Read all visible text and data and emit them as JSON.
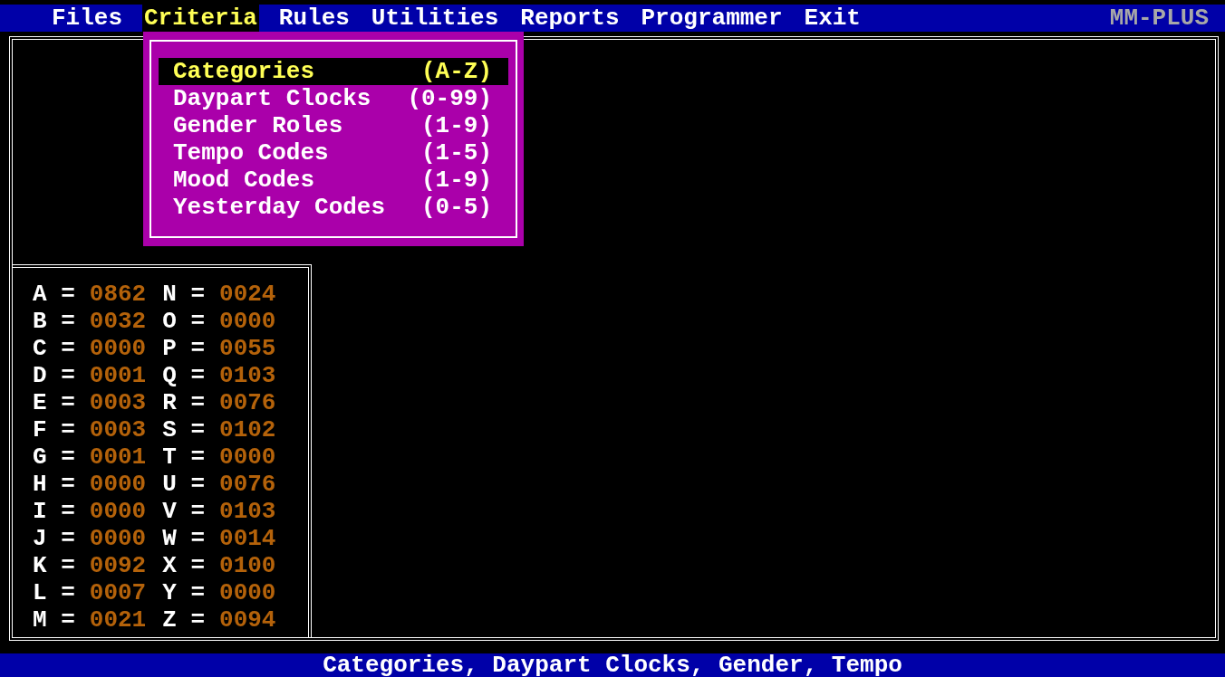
{
  "menu_bar": {
    "items": [
      {
        "label": "Files",
        "selected": false
      },
      {
        "label": "Criteria",
        "selected": true
      },
      {
        "label": "Rules",
        "selected": false
      },
      {
        "label": "Utilities",
        "selected": false
      },
      {
        "label": "Reports",
        "selected": false
      },
      {
        "label": "Programmer",
        "selected": false
      },
      {
        "label": "Exit",
        "selected": false
      }
    ],
    "app_name": "MM-PLUS"
  },
  "dropdown": {
    "items": [
      {
        "label": "Categories",
        "range": "(A-Z)",
        "selected": true
      },
      {
        "label": "Daypart Clocks",
        "range": "(0-99)",
        "selected": false
      },
      {
        "label": "Gender Roles",
        "range": "(1-9)",
        "selected": false
      },
      {
        "label": "Tempo Codes",
        "range": "(1-5)",
        "selected": false
      },
      {
        "label": "Mood Codes",
        "range": "(1-9)",
        "selected": false
      },
      {
        "label": "Yesterday Codes",
        "range": "(0-5)",
        "selected": false
      }
    ]
  },
  "category_counts": [
    {
      "label": "A =",
      "count": "0862"
    },
    {
      "label": "B =",
      "count": "0032"
    },
    {
      "label": "C =",
      "count": "0000"
    },
    {
      "label": "D =",
      "count": "0001"
    },
    {
      "label": "E =",
      "count": "0003"
    },
    {
      "label": "F =",
      "count": "0003"
    },
    {
      "label": "G =",
      "count": "0001"
    },
    {
      "label": "H =",
      "count": "0000"
    },
    {
      "label": "I =",
      "count": "0000"
    },
    {
      "label": "J =",
      "count": "0000"
    },
    {
      "label": "K =",
      "count": "0092"
    },
    {
      "label": "L =",
      "count": "0007"
    },
    {
      "label": "M =",
      "count": "0021"
    },
    {
      "label": "N =",
      "count": "0024"
    },
    {
      "label": "O =",
      "count": "0000"
    },
    {
      "label": "P =",
      "count": "0055"
    },
    {
      "label": "Q =",
      "count": "0103"
    },
    {
      "label": "R =",
      "count": "0076"
    },
    {
      "label": "S =",
      "count": "0102"
    },
    {
      "label": "T =",
      "count": "0000"
    },
    {
      "label": "U =",
      "count": "0076"
    },
    {
      "label": "V =",
      "count": "0103"
    },
    {
      "label": "W =",
      "count": "0014"
    },
    {
      "label": "X =",
      "count": "0100"
    },
    {
      "label": "Y =",
      "count": "0000"
    },
    {
      "label": "Z =",
      "count": "0094"
    }
  ],
  "status_bar": {
    "text": "Categories, Daypart Clocks, Gender, Tempo"
  }
}
